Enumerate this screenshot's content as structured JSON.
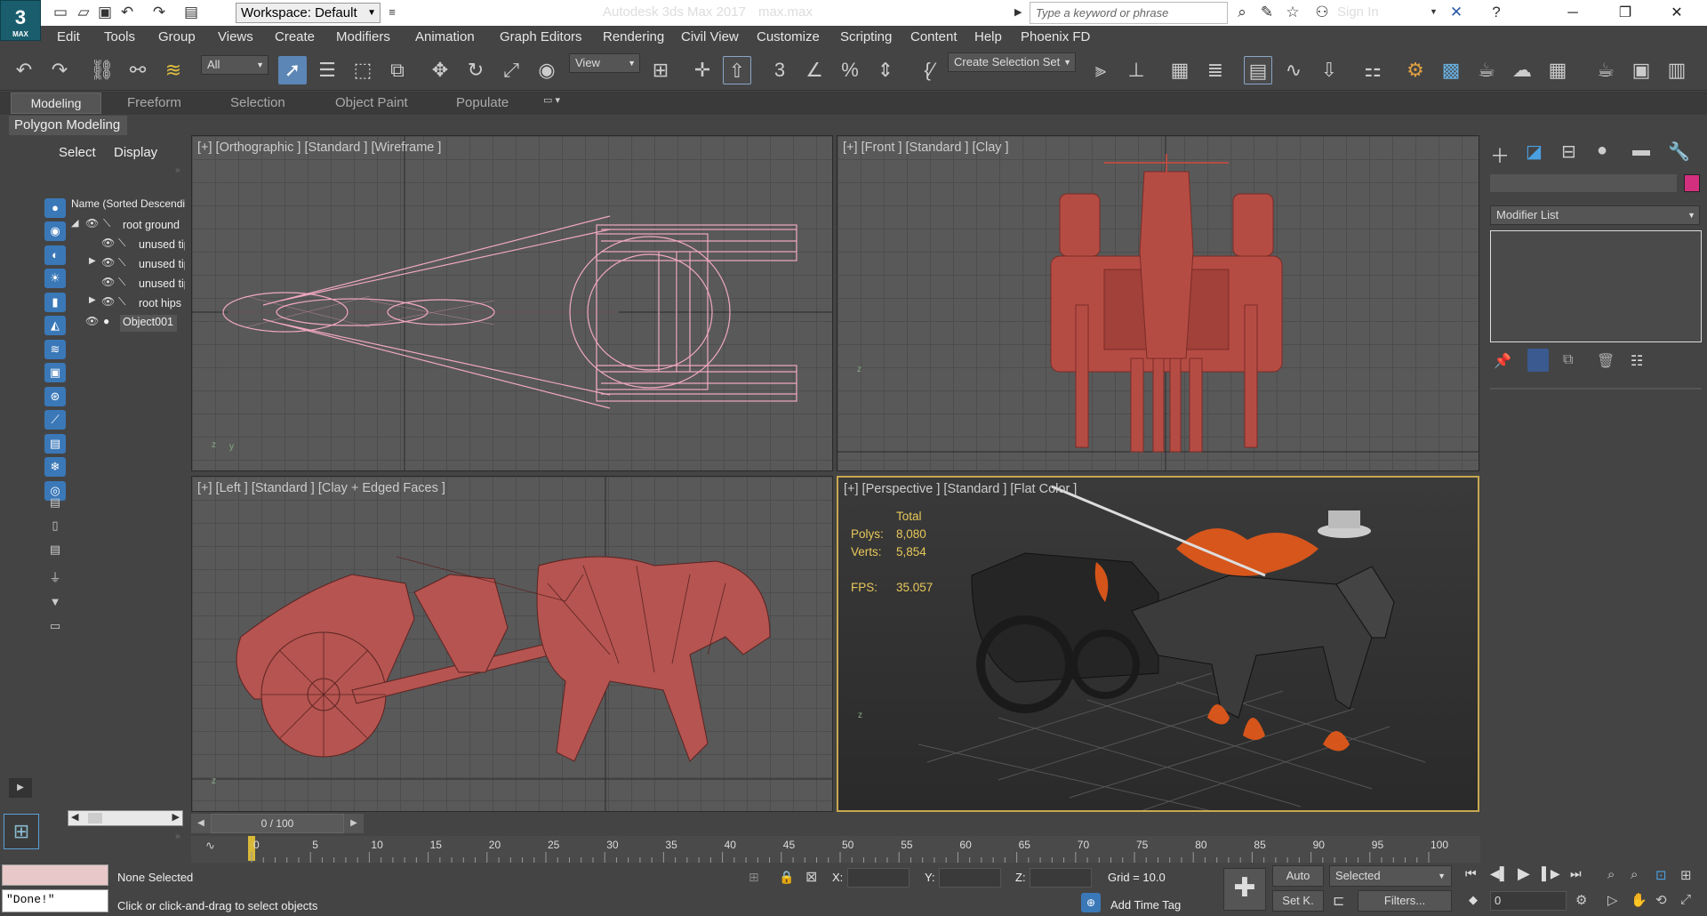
{
  "app": {
    "title": "Autodesk 3ds Max 2017",
    "file": "max.max",
    "logo_text": "3",
    "logo_sub": "MAX",
    "workspace": "Workspace: Default",
    "search_placeholder": "Type a keyword or phrase",
    "sign_in": "Sign In"
  },
  "menu": [
    "Edit",
    "Tools",
    "Group",
    "Views",
    "Create",
    "Modifiers",
    "Animation",
    "Graph Editors",
    "Rendering",
    "Civil View",
    "Customize",
    "Scripting",
    "Content",
    "Help",
    "Phoenix FD"
  ],
  "toolbar": {
    "selection_filter": "All",
    "ref_coord": "View",
    "selection_set": "Create Selection Set"
  },
  "ribbon": {
    "tabs": [
      "Modeling",
      "Freeform",
      "Selection",
      "Object Paint",
      "Populate"
    ],
    "subpanel": "Polygon Modeling"
  },
  "scene_explorer": {
    "tabs": [
      "Select",
      "Display"
    ],
    "column_header": "Name (Sorted Descending)",
    "items": [
      "root ground",
      "unused tip",
      "unused tip",
      "unused tip",
      "root hips",
      "Object001"
    ]
  },
  "viewports": {
    "top_left": "[+] [Orthographic ] [Standard ] [Wireframe ]",
    "top_right": "[+] [Front ] [Standard ] [Clay ]",
    "bottom_left": "[+] [Left ] [Standard ] [Clay + Edged Faces ]",
    "bottom_right": "[+] [Perspective ] [Standard ] [Flat Color ]"
  },
  "stats": {
    "total_label": "Total",
    "polys_label": "Polys:",
    "polys_value": "8,080",
    "verts_label": "Verts:",
    "verts_value": "5,854",
    "fps_label": "FPS:",
    "fps_value": "35.057"
  },
  "command_panel": {
    "modifier_list": "Modifier List",
    "swatch_color": "#d2307f"
  },
  "timeline": {
    "frame_display": "0 / 100",
    "ticks": [
      "0",
      "5",
      "10",
      "15",
      "20",
      "25",
      "30",
      "35",
      "40",
      "45",
      "50",
      "55",
      "60",
      "65",
      "70",
      "75",
      "80",
      "85",
      "90",
      "95",
      "100"
    ]
  },
  "status": {
    "maxscript_output": "\"Done!\"",
    "selection": "None Selected",
    "prompt": "Click or click-and-drag to select objects",
    "x_label": "X:",
    "y_label": "Y:",
    "z_label": "Z:",
    "grid": "Grid = 10.0",
    "add_time_tag": "Add Time Tag",
    "auto_key": "Auto",
    "set_key": "Set K.",
    "key_mode": "Selected",
    "filters": "Filters...",
    "current_frame": "0"
  }
}
